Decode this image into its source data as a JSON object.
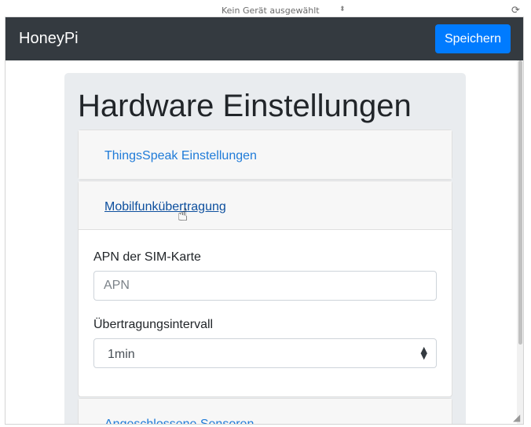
{
  "devtools": {
    "device_label": "Kein Gerät ausgewählt",
    "device_arrows": "⬍",
    "rotate_icon": "⟳"
  },
  "navbar": {
    "brand": "HoneyPi",
    "save_label": "Speichern"
  },
  "page": {
    "title": "Hardware Einstellungen"
  },
  "accordion": [
    {
      "label": "ThingsSpeak Einstellungen"
    },
    {
      "label": "Mobilfunkübertragung",
      "expanded": true
    },
    {
      "label": "Angeschlossene Sensoren"
    }
  ],
  "mobile": {
    "apn_label": "APN der SIM-Karte",
    "apn_placeholder": "APN",
    "apn_value": "",
    "interval_label": "Übertragungsintervall",
    "interval_value": "1min"
  },
  "colors": {
    "navbar_bg": "#343a40",
    "primary": "#007bff",
    "link": "#1f7bd8"
  },
  "icons": {
    "select_arrows": "⬍",
    "cursor": "hand-pointer",
    "resize": "◢"
  }
}
